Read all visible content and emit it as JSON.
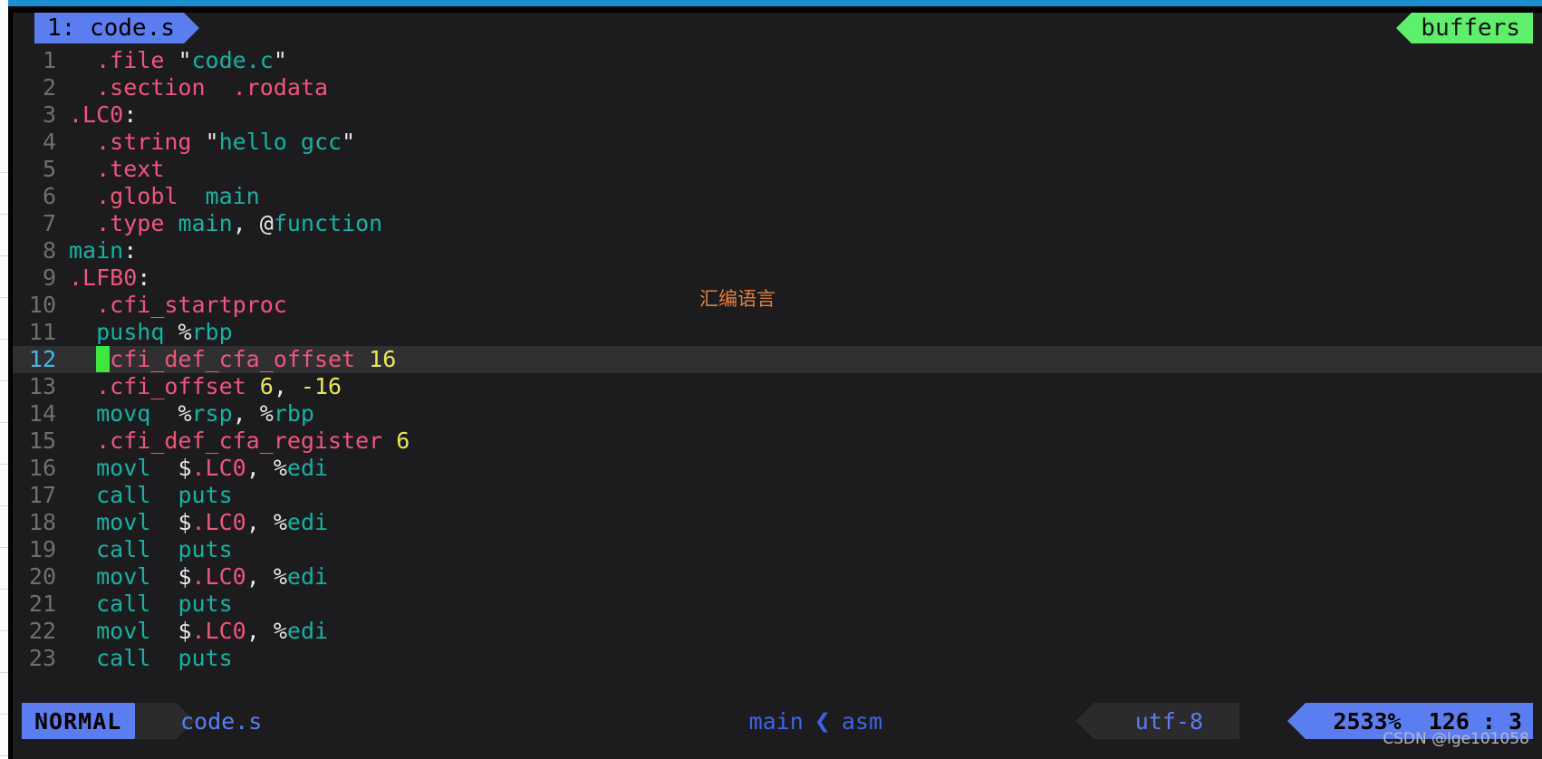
{
  "window": {
    "accent_bar_color": "#1a8fd0",
    "background": "#1c1c1e"
  },
  "tabline": {
    "tab_label": "1: code.s",
    "tab_color": "#5a7ef0",
    "buffers_label": "buffers",
    "buffers_color": "#5ef06a"
  },
  "annotation": {
    "text": "汇编语言",
    "color": "#e2803c"
  },
  "editor": {
    "filetype": "asm",
    "cursor_line": 12,
    "lines": [
      {
        "n": "1",
        "tokens": [
          {
            "t": "  ",
            "c": "pnc"
          },
          {
            "t": ".file",
            "c": "dir"
          },
          {
            "t": " ",
            "c": "pnc"
          },
          {
            "t": "\"",
            "c": "pnc"
          },
          {
            "t": "code.c",
            "c": "str"
          },
          {
            "t": "\"",
            "c": "pnc"
          }
        ]
      },
      {
        "n": "2",
        "tokens": [
          {
            "t": "  ",
            "c": "pnc"
          },
          {
            "t": ".section",
            "c": "dir"
          },
          {
            "t": "  ",
            "c": "pnc"
          },
          {
            "t": ".rodata",
            "c": "dir"
          }
        ]
      },
      {
        "n": "3",
        "tokens": [
          {
            "t": ".LC0",
            "c": "dir"
          },
          {
            "t": ":",
            "c": "pnc"
          }
        ]
      },
      {
        "n": "4",
        "tokens": [
          {
            "t": "  ",
            "c": "pnc"
          },
          {
            "t": ".string",
            "c": "dir"
          },
          {
            "t": " ",
            "c": "pnc"
          },
          {
            "t": "\"",
            "c": "pnc"
          },
          {
            "t": "hello gcc",
            "c": "str"
          },
          {
            "t": "\"",
            "c": "pnc"
          }
        ]
      },
      {
        "n": "5",
        "tokens": [
          {
            "t": "  ",
            "c": "pnc"
          },
          {
            "t": ".text",
            "c": "dir"
          }
        ]
      },
      {
        "n": "6",
        "tokens": [
          {
            "t": "  ",
            "c": "pnc"
          },
          {
            "t": ".globl",
            "c": "dir"
          },
          {
            "t": "  ",
            "c": "pnc"
          },
          {
            "t": "main",
            "c": "str"
          }
        ]
      },
      {
        "n": "7",
        "tokens": [
          {
            "t": "  ",
            "c": "pnc"
          },
          {
            "t": ".type",
            "c": "dir"
          },
          {
            "t": " ",
            "c": "pnc"
          },
          {
            "t": "main",
            "c": "str"
          },
          {
            "t": ", ",
            "c": "pnc"
          },
          {
            "t": "@",
            "c": "pnc"
          },
          {
            "t": "function",
            "c": "str"
          }
        ]
      },
      {
        "n": "8",
        "tokens": [
          {
            "t": "main",
            "c": "str"
          },
          {
            "t": ":",
            "c": "pnc"
          }
        ]
      },
      {
        "n": "9",
        "tokens": [
          {
            "t": ".LFB0",
            "c": "dir"
          },
          {
            "t": ":",
            "c": "pnc"
          }
        ]
      },
      {
        "n": "10",
        "tokens": [
          {
            "t": "  ",
            "c": "pnc"
          },
          {
            "t": ".cfi_startproc",
            "c": "dir"
          }
        ]
      },
      {
        "n": "11",
        "tokens": [
          {
            "t": "  ",
            "c": "pnc"
          },
          {
            "t": "pushq",
            "c": "ins"
          },
          {
            "t": " ",
            "c": "pnc"
          },
          {
            "t": "%",
            "c": "pnc"
          },
          {
            "t": "rbp",
            "c": "str"
          }
        ]
      },
      {
        "n": "12",
        "tokens": [
          {
            "t": "  ",
            "c": "pnc"
          },
          {
            "t": ".",
            "c": "cursor"
          },
          {
            "t": "cfi_def_cfa_offset",
            "c": "dir"
          },
          {
            "t": " ",
            "c": "pnc"
          },
          {
            "t": "16",
            "c": "num"
          }
        ]
      },
      {
        "n": "13",
        "tokens": [
          {
            "t": "  ",
            "c": "pnc"
          },
          {
            "t": ".cfi_offset",
            "c": "dir"
          },
          {
            "t": " ",
            "c": "pnc"
          },
          {
            "t": "6",
            "c": "num"
          },
          {
            "t": ", ",
            "c": "pnc"
          },
          {
            "t": "-16",
            "c": "num"
          }
        ]
      },
      {
        "n": "14",
        "tokens": [
          {
            "t": "  ",
            "c": "pnc"
          },
          {
            "t": "movq",
            "c": "ins"
          },
          {
            "t": "  ",
            "c": "pnc"
          },
          {
            "t": "%",
            "c": "pnc"
          },
          {
            "t": "rsp",
            "c": "str"
          },
          {
            "t": ", ",
            "c": "pnc"
          },
          {
            "t": "%",
            "c": "pnc"
          },
          {
            "t": "rbp",
            "c": "str"
          }
        ]
      },
      {
        "n": "15",
        "tokens": [
          {
            "t": "  ",
            "c": "pnc"
          },
          {
            "t": ".cfi_def_cfa_register",
            "c": "dir"
          },
          {
            "t": " ",
            "c": "pnc"
          },
          {
            "t": "6",
            "c": "num"
          }
        ]
      },
      {
        "n": "16",
        "tokens": [
          {
            "t": "  ",
            "c": "pnc"
          },
          {
            "t": "movl",
            "c": "ins"
          },
          {
            "t": "  ",
            "c": "pnc"
          },
          {
            "t": "$",
            "c": "pnc"
          },
          {
            "t": ".LC0",
            "c": "dir"
          },
          {
            "t": ", ",
            "c": "pnc"
          },
          {
            "t": "%",
            "c": "pnc"
          },
          {
            "t": "edi",
            "c": "str"
          }
        ]
      },
      {
        "n": "17",
        "tokens": [
          {
            "t": "  ",
            "c": "pnc"
          },
          {
            "t": "call",
            "c": "ins"
          },
          {
            "t": "  ",
            "c": "pnc"
          },
          {
            "t": "puts",
            "c": "str"
          }
        ]
      },
      {
        "n": "18",
        "tokens": [
          {
            "t": "  ",
            "c": "pnc"
          },
          {
            "t": "movl",
            "c": "ins"
          },
          {
            "t": "  ",
            "c": "pnc"
          },
          {
            "t": "$",
            "c": "pnc"
          },
          {
            "t": ".LC0",
            "c": "dir"
          },
          {
            "t": ", ",
            "c": "pnc"
          },
          {
            "t": "%",
            "c": "pnc"
          },
          {
            "t": "edi",
            "c": "str"
          }
        ]
      },
      {
        "n": "19",
        "tokens": [
          {
            "t": "  ",
            "c": "pnc"
          },
          {
            "t": "call",
            "c": "ins"
          },
          {
            "t": "  ",
            "c": "pnc"
          },
          {
            "t": "puts",
            "c": "str"
          }
        ]
      },
      {
        "n": "20",
        "tokens": [
          {
            "t": "  ",
            "c": "pnc"
          },
          {
            "t": "movl",
            "c": "ins"
          },
          {
            "t": "  ",
            "c": "pnc"
          },
          {
            "t": "$",
            "c": "pnc"
          },
          {
            "t": ".LC0",
            "c": "dir"
          },
          {
            "t": ", ",
            "c": "pnc"
          },
          {
            "t": "%",
            "c": "pnc"
          },
          {
            "t": "edi",
            "c": "str"
          }
        ]
      },
      {
        "n": "21",
        "tokens": [
          {
            "t": "  ",
            "c": "pnc"
          },
          {
            "t": "call",
            "c": "ins"
          },
          {
            "t": "  ",
            "c": "pnc"
          },
          {
            "t": "puts",
            "c": "str"
          }
        ]
      },
      {
        "n": "22",
        "tokens": [
          {
            "t": "  ",
            "c": "pnc"
          },
          {
            "t": "movl",
            "c": "ins"
          },
          {
            "t": "  ",
            "c": "pnc"
          },
          {
            "t": "$",
            "c": "pnc"
          },
          {
            "t": ".LC0",
            "c": "dir"
          },
          {
            "t": ", ",
            "c": "pnc"
          },
          {
            "t": "%",
            "c": "pnc"
          },
          {
            "t": "edi",
            "c": "str"
          }
        ]
      },
      {
        "n": "23",
        "tokens": [
          {
            "t": "  ",
            "c": "pnc"
          },
          {
            "t": "call",
            "c": "ins"
          },
          {
            "t": "  ",
            "c": "pnc"
          },
          {
            "t": "puts",
            "c": "str"
          }
        ]
      }
    ]
  },
  "statusline": {
    "mode": "NORMAL",
    "filename": "code.s",
    "function": "main",
    "separator_icon": "chevron-left-icon",
    "filetype": "asm",
    "encoding": "utf-8",
    "percent": "2533%",
    "line": "126",
    "colon": ":",
    "column": "3",
    "mode_color": "#5a7ef0",
    "segment_color": "#2b2b2e"
  },
  "watermark": {
    "text": "CSDN @lge101058"
  }
}
